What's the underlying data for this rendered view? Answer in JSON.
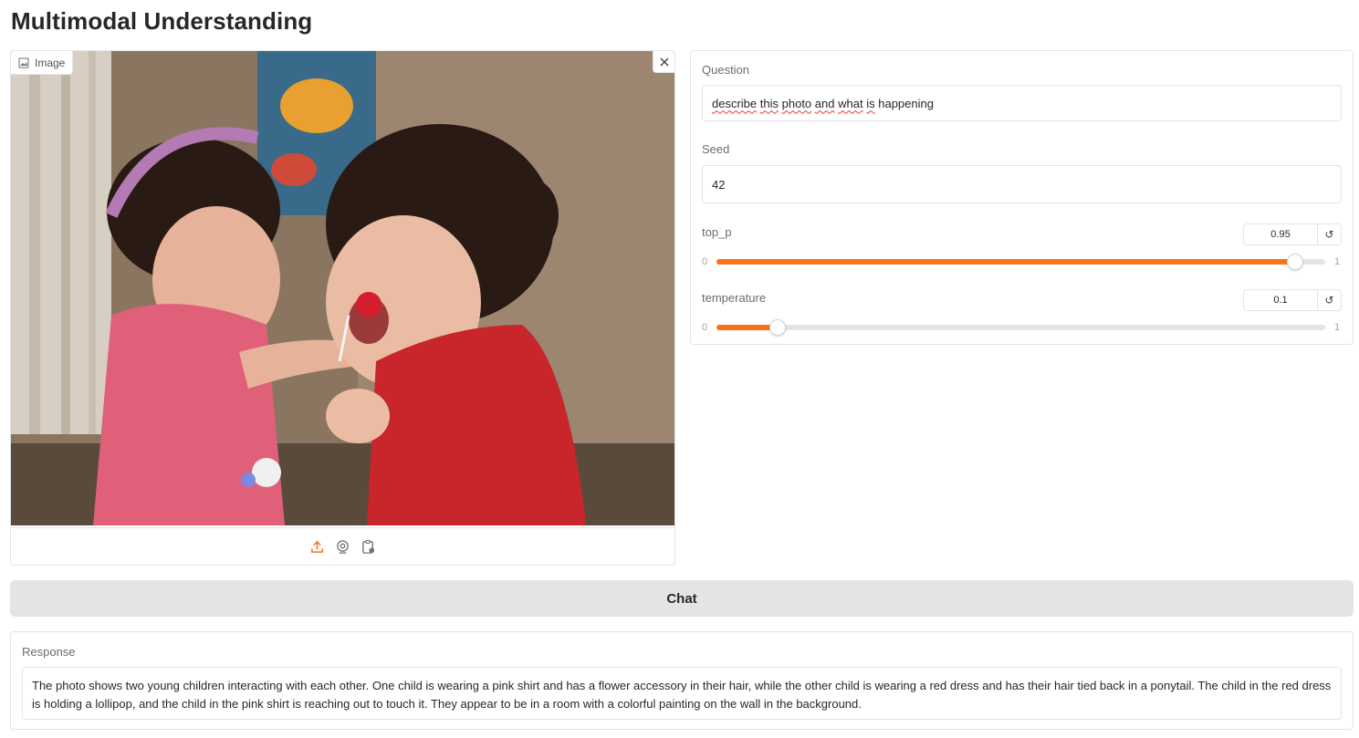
{
  "page": {
    "title": "Multimodal Understanding"
  },
  "image_input": {
    "label": "Image",
    "label_icon": "image-icon",
    "clear_icon": "close-icon",
    "sources": [
      {
        "icon": "upload-icon",
        "active": true
      },
      {
        "icon": "webcam-icon",
        "active": false
      },
      {
        "icon": "clipboard-icon",
        "active": false
      }
    ]
  },
  "question": {
    "label": "Question",
    "value": "describe this photo and what is happening"
  },
  "seed": {
    "label": "Seed",
    "value": "42"
  },
  "top_p": {
    "label": "top_p",
    "value": "0.95",
    "min": "0",
    "max": "1",
    "fraction": 0.95,
    "reset_icon": "↺"
  },
  "temperature": {
    "label": "temperature",
    "value": "0.1",
    "min": "0",
    "max": "1",
    "fraction": 0.1,
    "reset_icon": "↺"
  },
  "chat_button": {
    "label": "Chat"
  },
  "response": {
    "label": "Response",
    "text": "The photo shows two young children interacting with each other. One child is wearing a pink shirt and has a flower accessory in their hair, while the other child is wearing a red dress and has their hair tied back in a ponytail. The child in the red dress is holding a lollipop, and the child in the pink shirt is reaching out to touch it. They appear to be in a room with a colorful painting on the wall in the background."
  },
  "colors": {
    "accent": "#f97316",
    "button_bg": "#e4e4e7",
    "border": "#e4e4e7"
  }
}
